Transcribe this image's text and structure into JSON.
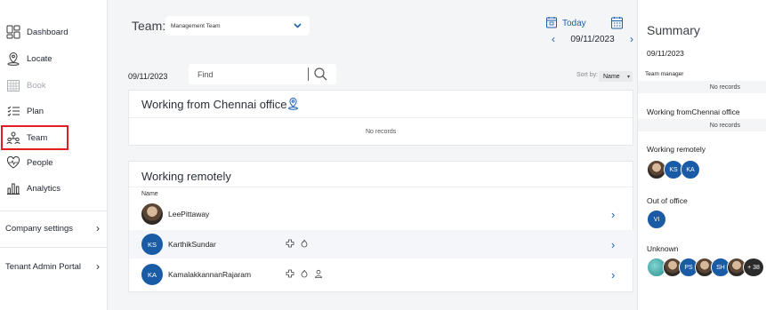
{
  "sidebar": {
    "items": [
      {
        "label": "Dashboard",
        "icon": "dashboard-icon"
      },
      {
        "label": "Locate",
        "icon": "locate-icon"
      },
      {
        "label": "Book",
        "icon": "calendar-grid-icon"
      },
      {
        "label": "Plan",
        "icon": "plan-list-icon"
      },
      {
        "label": "Team",
        "icon": "team-icon"
      },
      {
        "label": "People",
        "icon": "people-heart-icon"
      },
      {
        "label": "Analytics",
        "icon": "analytics-bars-icon"
      }
    ],
    "settings": [
      {
        "label": "Company settings"
      },
      {
        "label": "Tenant Admin Portal"
      }
    ]
  },
  "header": {
    "team_label": "Team:",
    "team_value": "Management Team",
    "today_label": "Today",
    "current_date": "09/11/2023"
  },
  "toolbar": {
    "date": "09/11/2023",
    "find_placeholder": "Find",
    "sort_label": "Sort by:",
    "sort_value": "Name"
  },
  "chennai_card": {
    "title": "Working from Chennai office",
    "no_records": "No records"
  },
  "remote_card": {
    "title": "Working remotely",
    "column_name": "Name",
    "people": [
      {
        "name": "LeePittaway",
        "initials": "",
        "photo": true
      },
      {
        "name": "KarthikSundar",
        "initials": "KS",
        "photo": false
      },
      {
        "name": "KamalakkannanRajaram",
        "initials": "KA",
        "photo": false
      }
    ]
  },
  "summary": {
    "title": "Summary",
    "date": "09/11/2023",
    "team_manager_label": "Team manager",
    "team_manager_no_records": "No records",
    "chennai_label": "Working fromChennai office",
    "chennai_no_records": "No records",
    "remote_label": "Working remotely",
    "remote_avatars": [
      "",
      "KS",
      "KA"
    ],
    "out_of_office_label": "Out of office",
    "out_of_office_avatars": [
      "VI"
    ],
    "unknown_label": "Unknown",
    "unknown_avatars": [
      "",
      "",
      "PS",
      "",
      "SH",
      ""
    ],
    "unknown_more": "+ 38"
  },
  "colors": {
    "accent": "#1b5fae",
    "avatar_blue": "#1a5ba6",
    "active_outline": "#e02020"
  }
}
